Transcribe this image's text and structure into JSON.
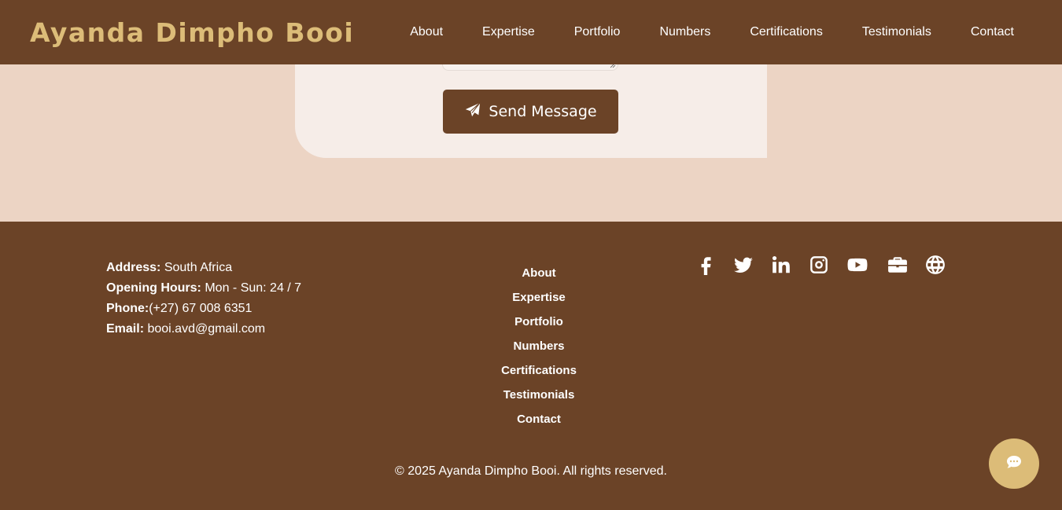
{
  "header": {
    "brand": "Ayanda Dimpho Booi",
    "nav": [
      "About",
      "Expertise",
      "Portfolio",
      "Numbers",
      "Certifications",
      "Testimonials",
      "Contact"
    ]
  },
  "contact_form": {
    "send_label": "Send Message",
    "send_icon": "paper-plane-icon"
  },
  "footer": {
    "info": {
      "address_label": "Address:",
      "address_value": "South Africa",
      "hours_label": "Opening Hours:",
      "hours_value": "Mon - Sun: 24 / 7",
      "phone_label": "Phone:",
      "phone_value": "(+27) 67 008 6351",
      "email_label": "Email:",
      "email_value": "booi.avd@gmail.com"
    },
    "links": [
      "About",
      "Expertise",
      "Portfolio",
      "Numbers",
      "Certifications",
      "Testimonials",
      "Contact"
    ],
    "social_icons": [
      "facebook-icon",
      "twitter-icon",
      "linkedin-icon",
      "instagram-icon",
      "youtube-icon",
      "briefcase-icon",
      "globe-icon"
    ],
    "copyright": "© 2025 Ayanda Dimpho Booi. All rights reserved."
  },
  "chat": {
    "icon": "chat-bubble-icon"
  },
  "colors": {
    "brown": "#6b4327",
    "gold": "#dcbc78",
    "page_bg": "#ecd4c4",
    "panel_bg": "#f6ede8"
  }
}
